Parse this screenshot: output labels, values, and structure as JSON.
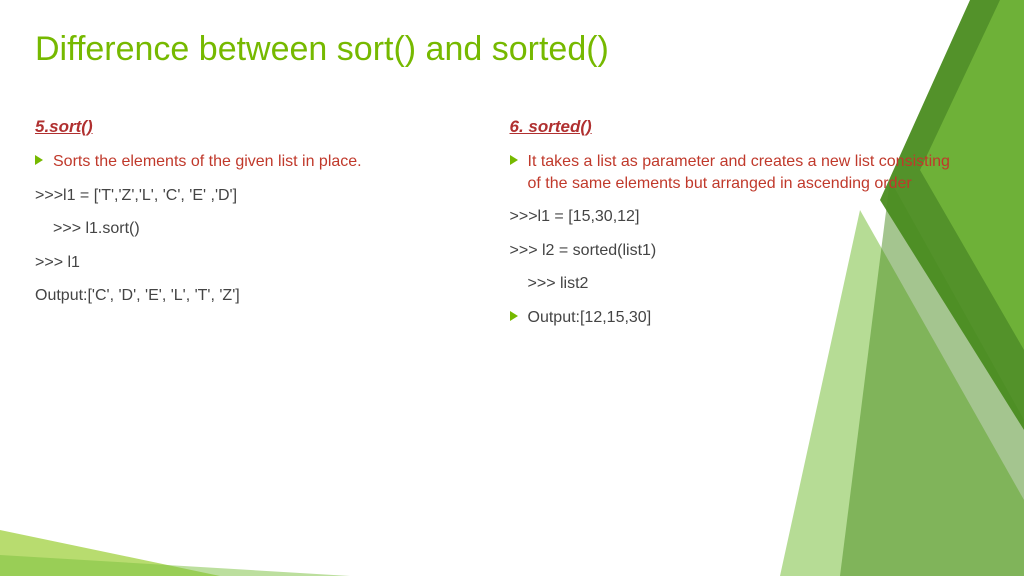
{
  "title": "Difference between sort() and sorted()",
  "left": {
    "heading": "5.sort()",
    "desc": "Sorts the elements of the given list in place.",
    "code1": ">>>l1 = ['T','Z','L', 'C', 'E' ,'D']",
    "code2": ">>> l1.sort()",
    "code3": ">>> l1",
    "output": "Output:['C', 'D', 'E', 'L', 'T', 'Z']"
  },
  "right": {
    "heading": "6. sorted()",
    "desc": "It takes a list as parameter and creates a new list consisting of the same elements but arranged in ascending order",
    "code1": ">>>l1 = [15,30,12]",
    "code2": ">>> l2 = sorted(list1)",
    "code3": ">>> list2",
    "output": "Output:[12,15,30]"
  }
}
